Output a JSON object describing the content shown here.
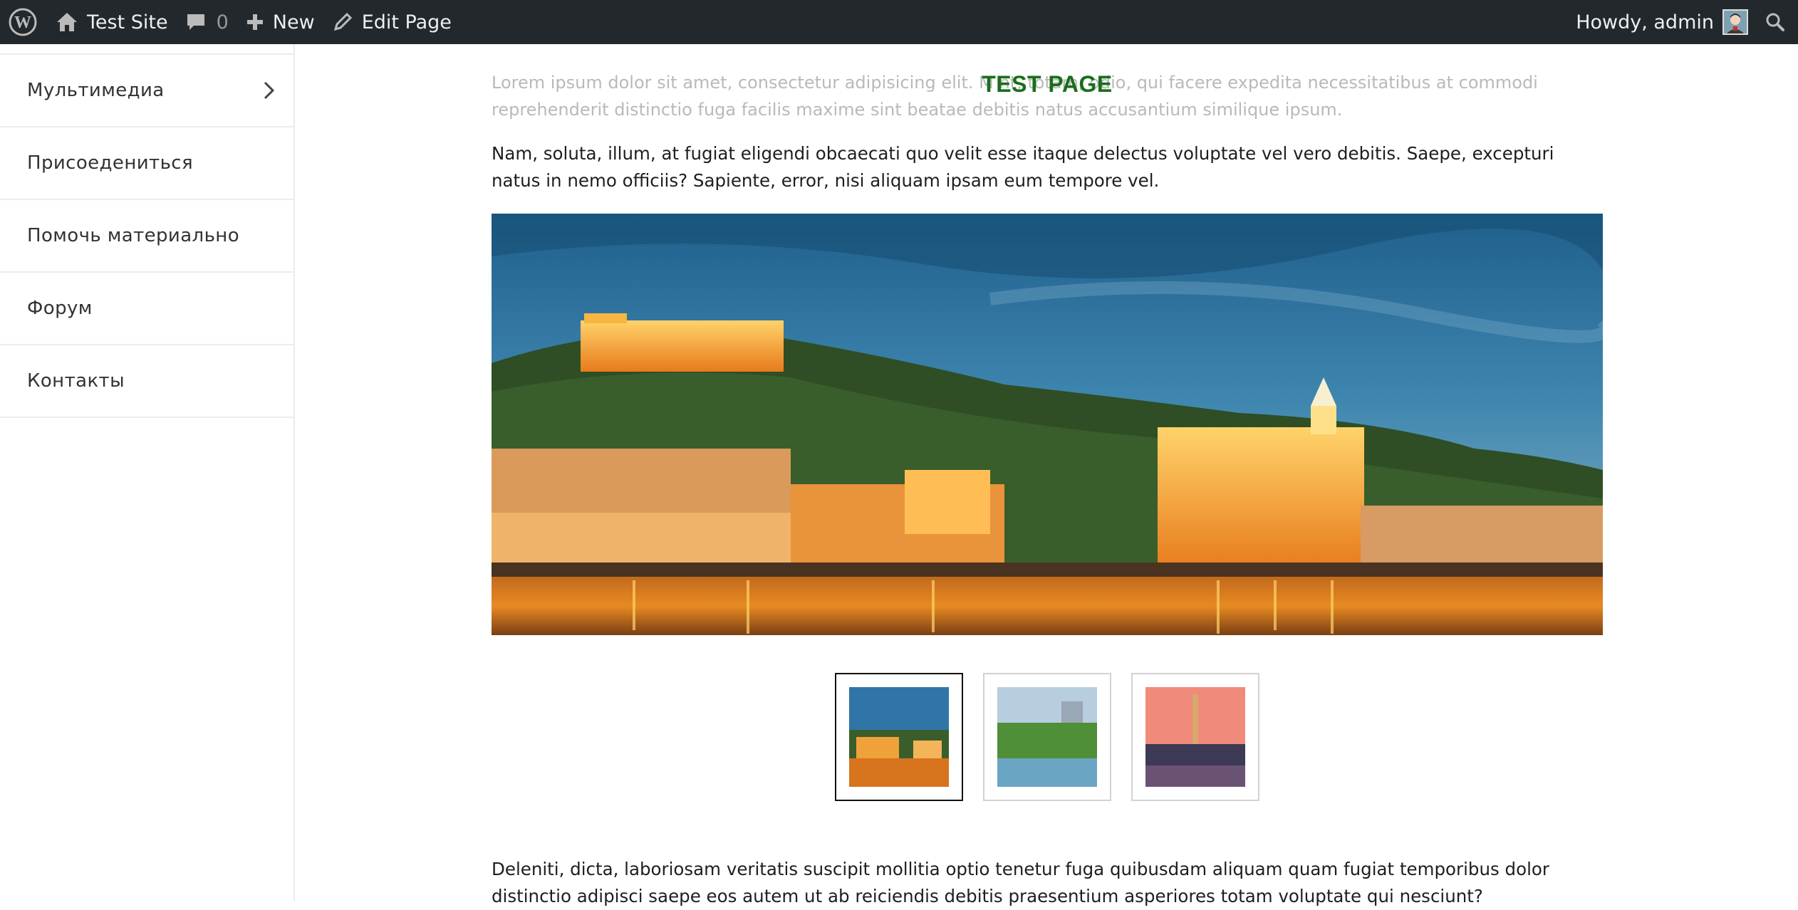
{
  "admin_bar": {
    "site_name": "Test Site",
    "comments_count": "0",
    "new_label": "New",
    "edit_label": "Edit Page",
    "howdy_label": "Howdy, admin"
  },
  "sidebar": {
    "items": [
      {
        "label": "Мультимедиа",
        "has_submenu": true
      },
      {
        "label": "Присоедениться",
        "has_submenu": false
      },
      {
        "label": "Помочь материально",
        "has_submenu": false
      },
      {
        "label": "Форум",
        "has_submenu": false
      },
      {
        "label": "Контакты",
        "has_submenu": false
      }
    ]
  },
  "page": {
    "title": "TEST PAGE",
    "intro_faded": "Lorem ipsum dolor sit amet, consectetur adipisicing elit. M               nt, totam, odio, qui facere expedita necessitatibus at commodi reprehenderit distinctio fuga facilis maxime sint beatae debitis natus accusantium similique ipsum.",
    "paragraph_1": "Nam, soluta, illum, at fugiat eligendi obcaecati quo velit esse itaque delectus voluptate vel vero debitis. Saepe, excepturi natus in nemo officiis? Sapiente, error, nisi aliquam ipsam eum tempore vel.",
    "paragraph_2": "Deleniti, dicta, laboriosam veritatis suscipit mollitia optio tenetur fuga quibusdam aliquam quam fugiat temporibus dolor distinctio adipisci saepe eos autem ut ab reiciendis debitis praesentium asperiores totam voluptate qui nesciunt?"
  },
  "gallery": {
    "active_index": 0,
    "thumbnails": [
      "city-evening-thumbnail",
      "river-park-thumbnail",
      "sunset-monument-thumbnail"
    ]
  },
  "colors": {
    "admin_bar_bg": "#23282d",
    "title_green": "#1a6e1a",
    "border": "#ececec"
  }
}
